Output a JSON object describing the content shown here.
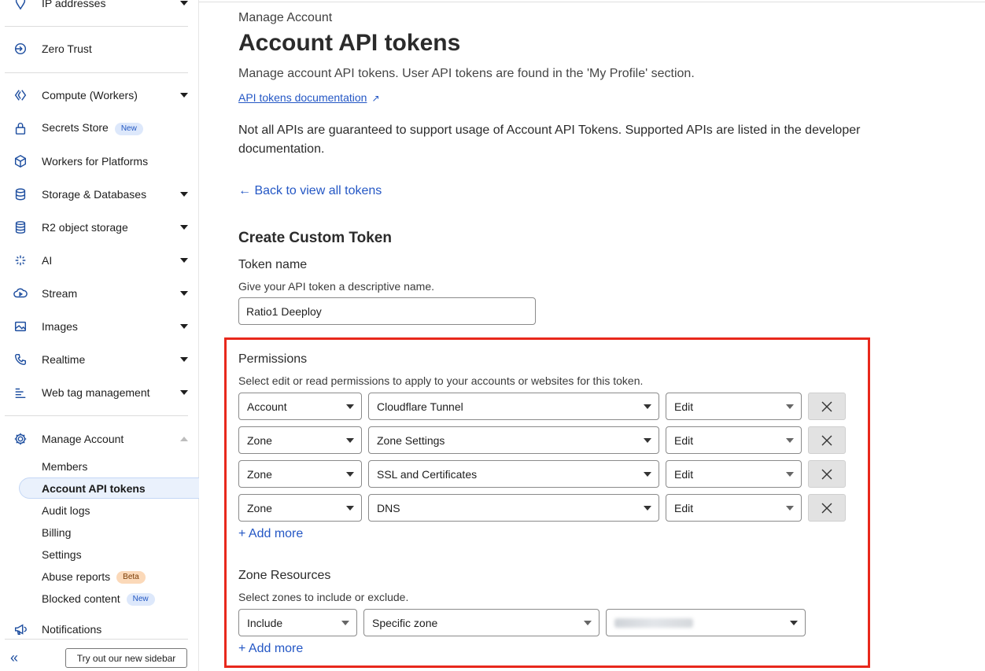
{
  "sidebar": {
    "top_item": "IP addresses",
    "items": [
      {
        "label": "Zero Trust",
        "icon": "zero-trust-icon",
        "caret": false
      },
      {
        "label": "Compute (Workers)",
        "icon": "workers-icon",
        "caret": true
      },
      {
        "label": "Secrets Store",
        "icon": "lock-icon",
        "caret": false,
        "badge": "New"
      },
      {
        "label": "Workers for Platforms",
        "icon": "cube-icon",
        "caret": false
      },
      {
        "label": "Storage & Databases",
        "icon": "database-icon",
        "caret": true
      },
      {
        "label": "R2 object storage",
        "icon": "storage-icon",
        "caret": true
      },
      {
        "label": "AI",
        "icon": "sparkle-icon",
        "caret": true
      },
      {
        "label": "Stream",
        "icon": "cloud-play-icon",
        "caret": true
      },
      {
        "label": "Images",
        "icon": "image-icon",
        "caret": true
      },
      {
        "label": "Realtime",
        "icon": "phone-icon",
        "caret": true
      },
      {
        "label": "Web tag management",
        "icon": "tag-list-icon",
        "caret": true
      }
    ],
    "manage_account": {
      "label": "Manage Account",
      "icon": "gear-icon",
      "children": [
        {
          "label": "Members"
        },
        {
          "label": "Account API tokens",
          "active": true
        },
        {
          "label": "Audit logs"
        },
        {
          "label": "Billing"
        },
        {
          "label": "Settings"
        },
        {
          "label": "Abuse reports",
          "badge": "Beta"
        },
        {
          "label": "Blocked content",
          "badge": "New"
        }
      ]
    },
    "notifications": {
      "label": "Notifications",
      "icon": "megaphone-icon"
    },
    "collapse_icon": "double-chevron-left-icon",
    "try_sidebar_label": "Try out our new sidebar"
  },
  "header": {
    "breadcrumb": "Manage Account",
    "title": "Account API tokens",
    "subtitle": "Manage account API tokens. User API tokens are found in the 'My Profile' section.",
    "doc_link": "API tokens documentation",
    "note": "Not all APIs are guaranteed to support usage of Account API Tokens. Supported APIs are listed in the developer documentation.",
    "back_link": "← Back to view all tokens"
  },
  "form": {
    "section_title": "Create Custom Token",
    "token_name_label": "Token name",
    "token_name_help": "Give your API token a descriptive name.",
    "token_name_value": "Ratio1 Deeploy",
    "permissions": {
      "label": "Permissions",
      "help": "Select edit or read permissions to apply to your accounts or websites for this token.",
      "rows": [
        {
          "scope": "Account",
          "resource": "Cloudflare Tunnel",
          "access": "Edit"
        },
        {
          "scope": "Zone",
          "resource": "Zone Settings",
          "access": "Edit"
        },
        {
          "scope": "Zone",
          "resource": "SSL and Certificates",
          "access": "Edit"
        },
        {
          "scope": "Zone",
          "resource": "DNS",
          "access": "Edit"
        }
      ],
      "add_more": "+ Add more"
    },
    "zone_resources": {
      "label": "Zone Resources",
      "help": "Select zones to include or exclude.",
      "include": "Include",
      "type": "Specific zone",
      "add_more": "+ Add more"
    }
  },
  "colors": {
    "accent": "#2457c5",
    "highlight": "#e8281c",
    "active_bg": "#eaf1fc"
  }
}
